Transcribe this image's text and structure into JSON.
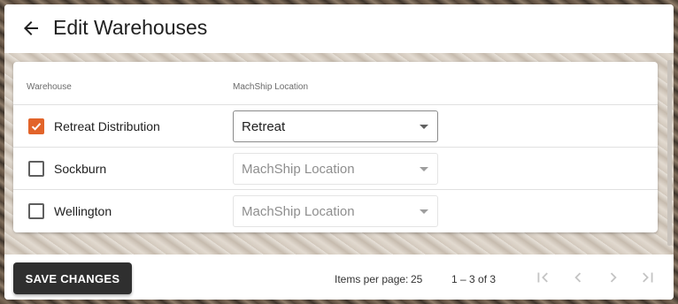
{
  "header": {
    "title": "Edit Warehouses",
    "back_icon": "arrow-left-icon"
  },
  "table": {
    "columns": [
      "Warehouse",
      "MachShip Location"
    ],
    "rows": [
      {
        "warehouse": "Retreat Distribution",
        "checked": true,
        "location": "Retreat",
        "location_placeholder": "MachShip Location"
      },
      {
        "warehouse": "Sockburn",
        "checked": false,
        "location": "MachShip Location",
        "location_placeholder": "MachShip Location"
      },
      {
        "warehouse": "Wellington",
        "checked": false,
        "location": "MachShip Location",
        "location_placeholder": "MachShip Location"
      }
    ]
  },
  "footer": {
    "save_label": "SAVE CHANGES",
    "items_per_page_label": "Items per page:",
    "items_per_page_value": "25",
    "range_label": "1 – 3 of 3",
    "first_page_icon": "first-page-icon",
    "prev_page_icon": "chevron-left-icon",
    "next_page_icon": "chevron-right-icon",
    "last_page_icon": "last-page-icon"
  },
  "colors": {
    "accent": "#e2642a",
    "button_bg": "#2f2f2f",
    "title_text": "#212121"
  }
}
